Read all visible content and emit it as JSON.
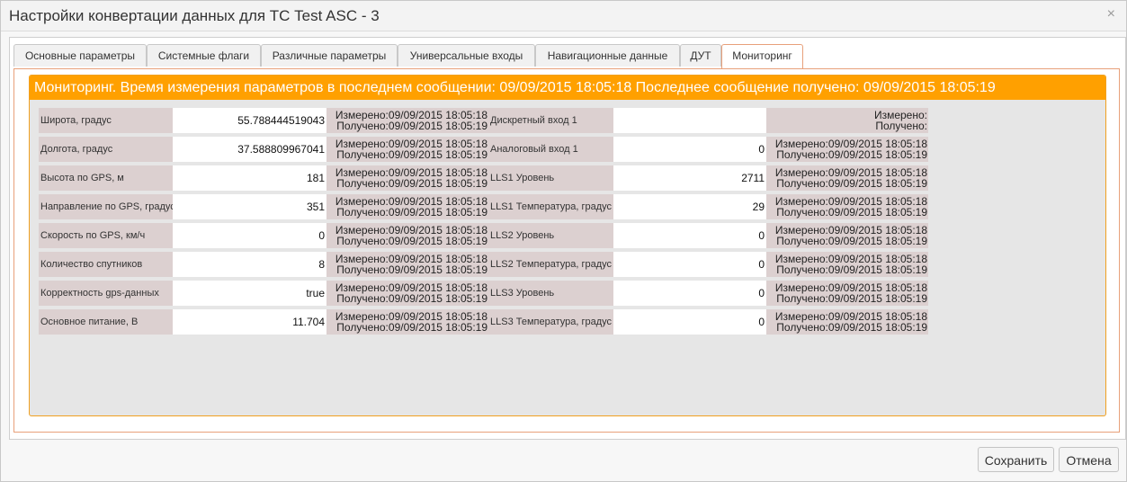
{
  "dialog": {
    "title": "Настройки конвертации данных для ТС Test ASC - 3",
    "close_glyph": "×"
  },
  "tabs": [
    {
      "label": "Основные параметры"
    },
    {
      "label": "Системные флаги"
    },
    {
      "label": "Различные параметры"
    },
    {
      "label": "Универсальные входы"
    },
    {
      "label": "Навигационные данные"
    },
    {
      "label": "ДУТ"
    },
    {
      "label": "Мониторинг"
    }
  ],
  "active_tab": "Мониторинг",
  "monitoring": {
    "header": "Мониторинг. Время измерения параметров в последнем сообщении: 09/09/2015 18:05:18 Последнее сообщение получено: 09/09/2015 18:05:19",
    "left": [
      {
        "label": "Широта, градус",
        "value": "55.788444519043",
        "measured": "Измерено:09/09/2015 18:05:18",
        "received": "Получено:09/09/2015 18:05:19"
      },
      {
        "label": "Долгота, градус",
        "value": "37.588809967041",
        "measured": "Измерено:09/09/2015 18:05:18",
        "received": "Получено:09/09/2015 18:05:19"
      },
      {
        "label": "Высота по GPS, м",
        "value": "181",
        "measured": "Измерено:09/09/2015 18:05:18",
        "received": "Получено:09/09/2015 18:05:19"
      },
      {
        "label": "Направление по GPS, градус",
        "value": "351",
        "measured": "Измерено:09/09/2015 18:05:18",
        "received": "Получено:09/09/2015 18:05:19"
      },
      {
        "label": "Скорость по GPS, км/ч",
        "value": "0",
        "measured": "Измерено:09/09/2015 18:05:18",
        "received": "Получено:09/09/2015 18:05:19"
      },
      {
        "label": "Количество спутников",
        "value": "8",
        "measured": "Измерено:09/09/2015 18:05:18",
        "received": "Получено:09/09/2015 18:05:19"
      },
      {
        "label": "Корректность gps-данных",
        "value": "true",
        "measured": "Измерено:09/09/2015 18:05:18",
        "received": "Получено:09/09/2015 18:05:19"
      },
      {
        "label": "Основное питание, В",
        "value": "11.704",
        "measured": "Измерено:09/09/2015 18:05:18",
        "received": "Получено:09/09/2015 18:05:19"
      }
    ],
    "right": [
      {
        "label": "Дискретный вход 1",
        "value": "",
        "measured": "Измерено:",
        "received": "Получено:"
      },
      {
        "label": "Аналоговый вход 1",
        "value": "0",
        "measured": "Измерено:09/09/2015 18:05:18",
        "received": "Получено:09/09/2015 18:05:19"
      },
      {
        "label": "LLS1 Уровень",
        "value": "2711",
        "measured": "Измерено:09/09/2015 18:05:18",
        "received": "Получено:09/09/2015 18:05:19"
      },
      {
        "label": "LLS1 Температура, градус",
        "value": "29",
        "measured": "Измерено:09/09/2015 18:05:18",
        "received": "Получено:09/09/2015 18:05:19"
      },
      {
        "label": "LLS2 Уровень",
        "value": "0",
        "measured": "Измерено:09/09/2015 18:05:18",
        "received": "Получено:09/09/2015 18:05:19"
      },
      {
        "label": "LLS2 Температура, градус",
        "value": "0",
        "measured": "Измерено:09/09/2015 18:05:18",
        "received": "Получено:09/09/2015 18:05:19"
      },
      {
        "label": "LLS3 Уровень",
        "value": "0",
        "measured": "Измерено:09/09/2015 18:05:18",
        "received": "Получено:09/09/2015 18:05:19"
      },
      {
        "label": "LLS3 Температура, градус",
        "value": "0",
        "measured": "Измерено:09/09/2015 18:05:18",
        "received": "Получено:09/09/2015 18:05:19"
      }
    ]
  },
  "buttons": {
    "save_label": "Сохранить",
    "cancel_label": "Отмена"
  },
  "colors": {
    "accent_orange": "#ffa000",
    "tab_border": "#e8a07a",
    "label_bg": "#dcd0d0",
    "panel_bg": "#e6e6e6"
  }
}
